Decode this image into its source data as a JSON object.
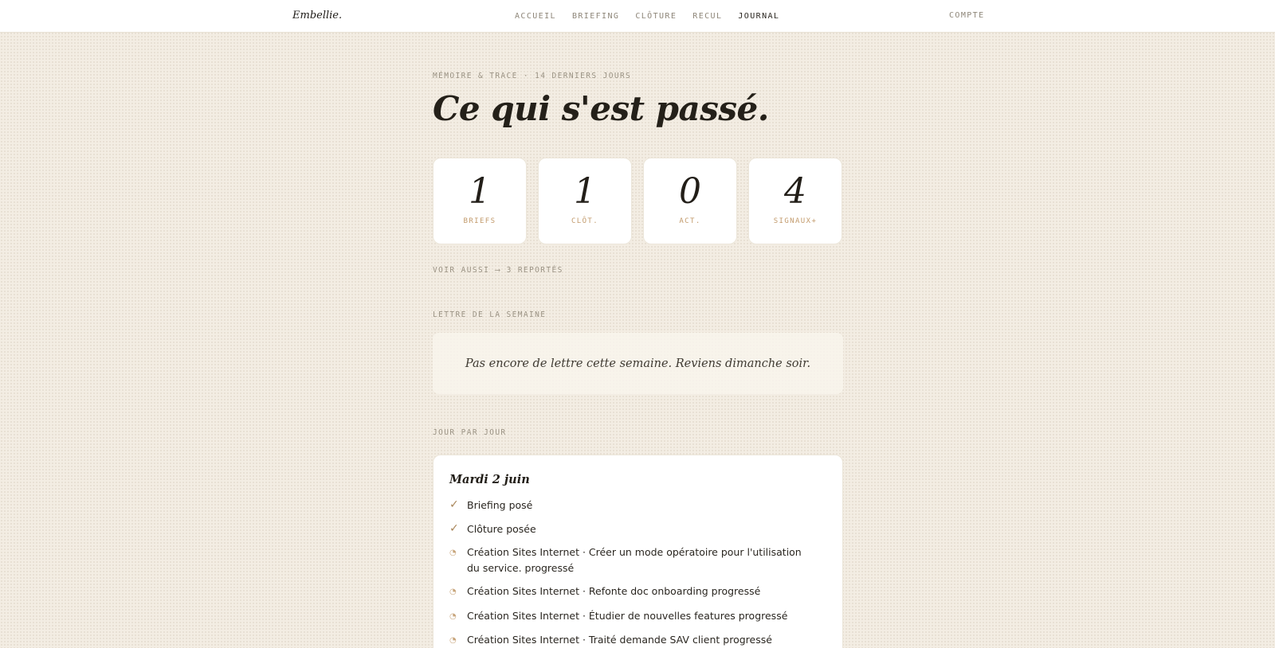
{
  "brand": "Embellie.",
  "nav": {
    "items": [
      {
        "label": "ACCUEIL",
        "active": false
      },
      {
        "label": "BRIEFING",
        "active": false
      },
      {
        "label": "CLÔTURE",
        "active": false
      },
      {
        "label": "RECUL",
        "active": false
      },
      {
        "label": "JOURNAL",
        "active": true
      }
    ],
    "account": "COMPTE"
  },
  "header": {
    "kicker": "MÉMOIRE & TRACE · 14 DERNIERS JOURS",
    "title": "Ce qui s'est passé."
  },
  "stats": [
    {
      "value": "1",
      "label": "BRIEFS"
    },
    {
      "value": "1",
      "label": "CLÔT."
    },
    {
      "value": "0",
      "label": "ACT."
    },
    {
      "value": "4",
      "label": "SIGNAUX+"
    }
  ],
  "see_also": {
    "prefix": "VOIR AUSSI",
    "arrow": "⟶",
    "link": "3 REPORTÉS"
  },
  "weekly_letter": {
    "label": "LETTRE DE LA SEMAINE",
    "empty_text": "Pas encore de lettre cette semaine. Reviens dimanche soir."
  },
  "days": {
    "label": "JOUR PAR JOUR",
    "items": [
      {
        "title": "Mardi 2 juin",
        "entries": [
          {
            "icon": "check-icon",
            "text": "Briefing posé"
          },
          {
            "icon": "check-icon",
            "text": "Clôture posée"
          },
          {
            "icon": "progress-icon",
            "text": "Création Sites Internet · Créer un mode opératoire pour l'utilisation du service. progressé"
          },
          {
            "icon": "progress-icon",
            "text": "Création Sites Internet · Refonte doc onboarding progressé"
          },
          {
            "icon": "progress-icon",
            "text": "Création Sites Internet · Étudier de nouvelles features progressé"
          },
          {
            "icon": "progress-icon",
            "text": "Création Sites Internet · Traité demande SAV client progressé"
          }
        ]
      }
    ]
  }
}
